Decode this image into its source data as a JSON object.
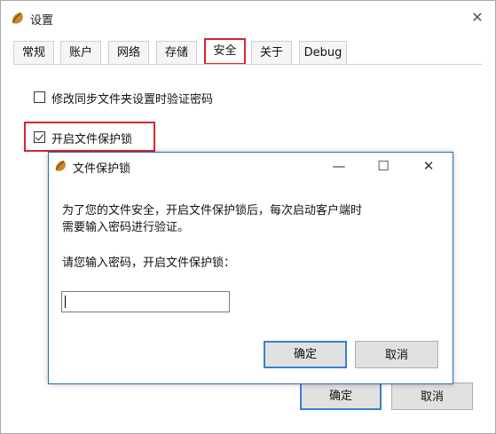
{
  "window": {
    "title": "设置",
    "close_glyph": "✕"
  },
  "tabs": [
    {
      "label": "常规",
      "active": false
    },
    {
      "label": "账户",
      "active": false
    },
    {
      "label": "网络",
      "active": false
    },
    {
      "label": "存储",
      "active": false
    },
    {
      "label": "安全",
      "active": true
    },
    {
      "label": "关于",
      "active": false
    },
    {
      "label": "Debug",
      "active": false
    }
  ],
  "security": {
    "option1": {
      "label": "修改同步文件夹设置时验证密码",
      "checked": false
    },
    "option2": {
      "label": "开启文件保护锁",
      "checked": true
    }
  },
  "footer": {
    "ok": "确定",
    "cancel": "取消"
  },
  "dialog": {
    "title": "文件保护锁",
    "minimize_glyph": "—",
    "maximize_glyph": "☐",
    "close_glyph": "✕",
    "line1": "为了您的文件安全，开启文件保护锁后，每次启动客户端时",
    "line2": "需要输入密码进行验证。",
    "prompt": "请您输入密码，开启文件保护锁：",
    "password_value": "",
    "ok": "确定",
    "cancel": "取消"
  },
  "colors": {
    "accent_red": "#d9242b",
    "focus_blue": "#3a80d0"
  },
  "icons": {
    "app": "acorn-icon"
  }
}
